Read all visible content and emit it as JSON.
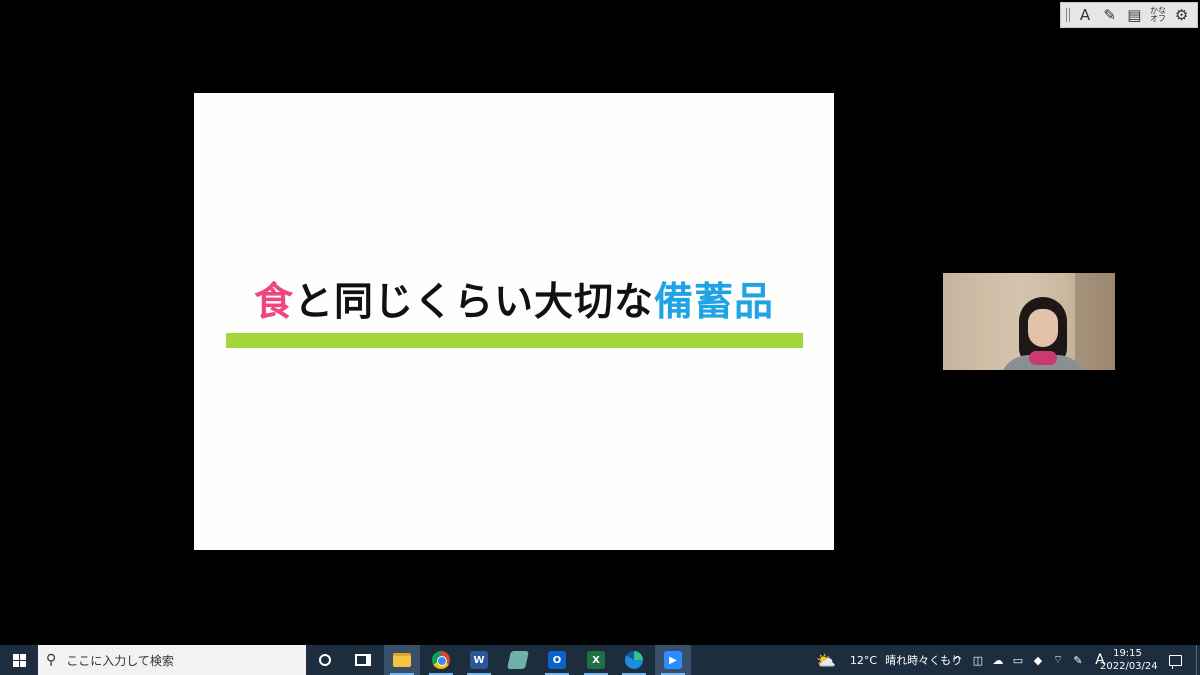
{
  "ime_toolbar": {
    "input_mode": "A",
    "kana_toggle": "かなオフ"
  },
  "slide": {
    "title_part1": "食",
    "title_part2": "と同じくらい大切な",
    "title_part3": "備蓄品",
    "colors": {
      "accent_pink": "#f0467f",
      "accent_blue": "#1fa3e6",
      "underline_green": "#a3d63a"
    }
  },
  "taskbar": {
    "search_placeholder": "ここに入力して検索",
    "apps": [
      "cortana",
      "task-view",
      "file-explorer",
      "chrome",
      "word",
      "notes",
      "outlook",
      "excel",
      "edge",
      "zoom"
    ],
    "word_letter": "W",
    "outlook_letter": "O",
    "excel_letter": "X",
    "weather_temp": "12°C",
    "weather_text": "晴れ時々くもり",
    "ime_indicator": "A",
    "clock_time": "19:15",
    "clock_date": "2022/03/24"
  }
}
